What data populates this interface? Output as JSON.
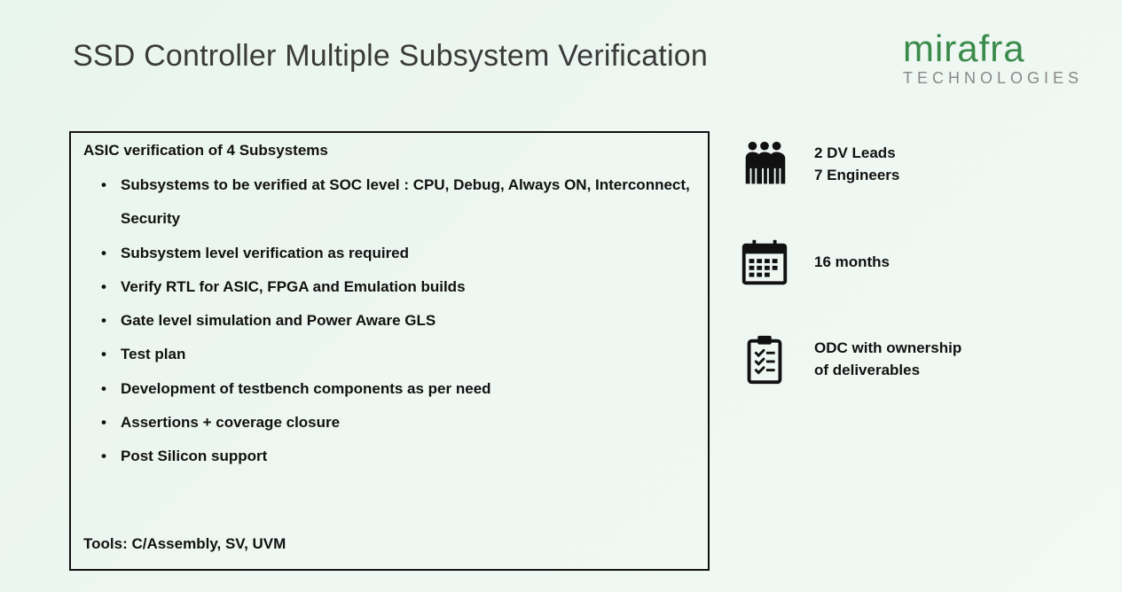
{
  "title": "SSD Controller Multiple Subsystem Verification",
  "logo": {
    "main": "mirafra",
    "sub": "TECHNOLOGIES"
  },
  "box": {
    "heading": "ASIC verification of 4 Subsystems",
    "bullets": [
      "Subsystems to be verified at SOC level : CPU, Debug, Always ON, Interconnect, Security",
      "Subsystem level verification as required",
      "Verify RTL for ASIC, FPGA and Emulation builds",
      "Gate level simulation and Power Aware GLS",
      "Test plan",
      "Development of testbench components as per need",
      "Assertions + coverage closure",
      "Post Silicon support"
    ],
    "tools_label": "Tools: ",
    "tools_value": "C/Assembly, SV, UVM"
  },
  "side": {
    "team": {
      "line1": "2 DV Leads",
      "line2": "7 Engineers"
    },
    "duration": "16 months",
    "deliverables": {
      "line1": "ODC with ownership",
      "line2": "of deliverables"
    }
  }
}
